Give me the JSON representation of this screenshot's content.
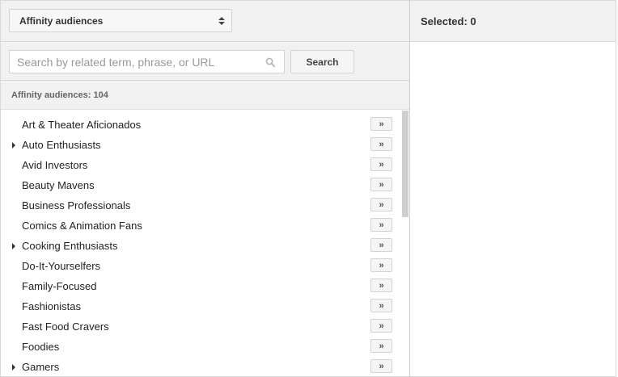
{
  "dropdown": {
    "selected": "Affinity audiences"
  },
  "search": {
    "placeholder": "Search by related term, phrase, or URL",
    "button_label": "Search"
  },
  "count_label": "Affinity audiences: 104",
  "selected_label": "Selected: 0",
  "add_button_glyph": "»",
  "items": [
    {
      "label": "Art & Theater Aficionados",
      "expandable": false
    },
    {
      "label": "Auto Enthusiasts",
      "expandable": true
    },
    {
      "label": "Avid Investors",
      "expandable": false
    },
    {
      "label": "Beauty Mavens",
      "expandable": false
    },
    {
      "label": "Business Professionals",
      "expandable": false
    },
    {
      "label": "Comics & Animation Fans",
      "expandable": false
    },
    {
      "label": "Cooking Enthusiasts",
      "expandable": true
    },
    {
      "label": "Do-It-Yourselfers",
      "expandable": false
    },
    {
      "label": "Family-Focused",
      "expandable": false
    },
    {
      "label": "Fashionistas",
      "expandable": false
    },
    {
      "label": "Fast Food Cravers",
      "expandable": false
    },
    {
      "label": "Foodies",
      "expandable": false
    },
    {
      "label": "Gamers",
      "expandable": true
    }
  ],
  "icons": {
    "dropdown": "up-down-arrows-icon",
    "search": "search-icon",
    "expand": "caret-right-icon"
  },
  "colors": {
    "panel_bg": "#f1f1f1",
    "border": "#d9d9d9",
    "scroll_thumb": "#cfcfcf"
  }
}
